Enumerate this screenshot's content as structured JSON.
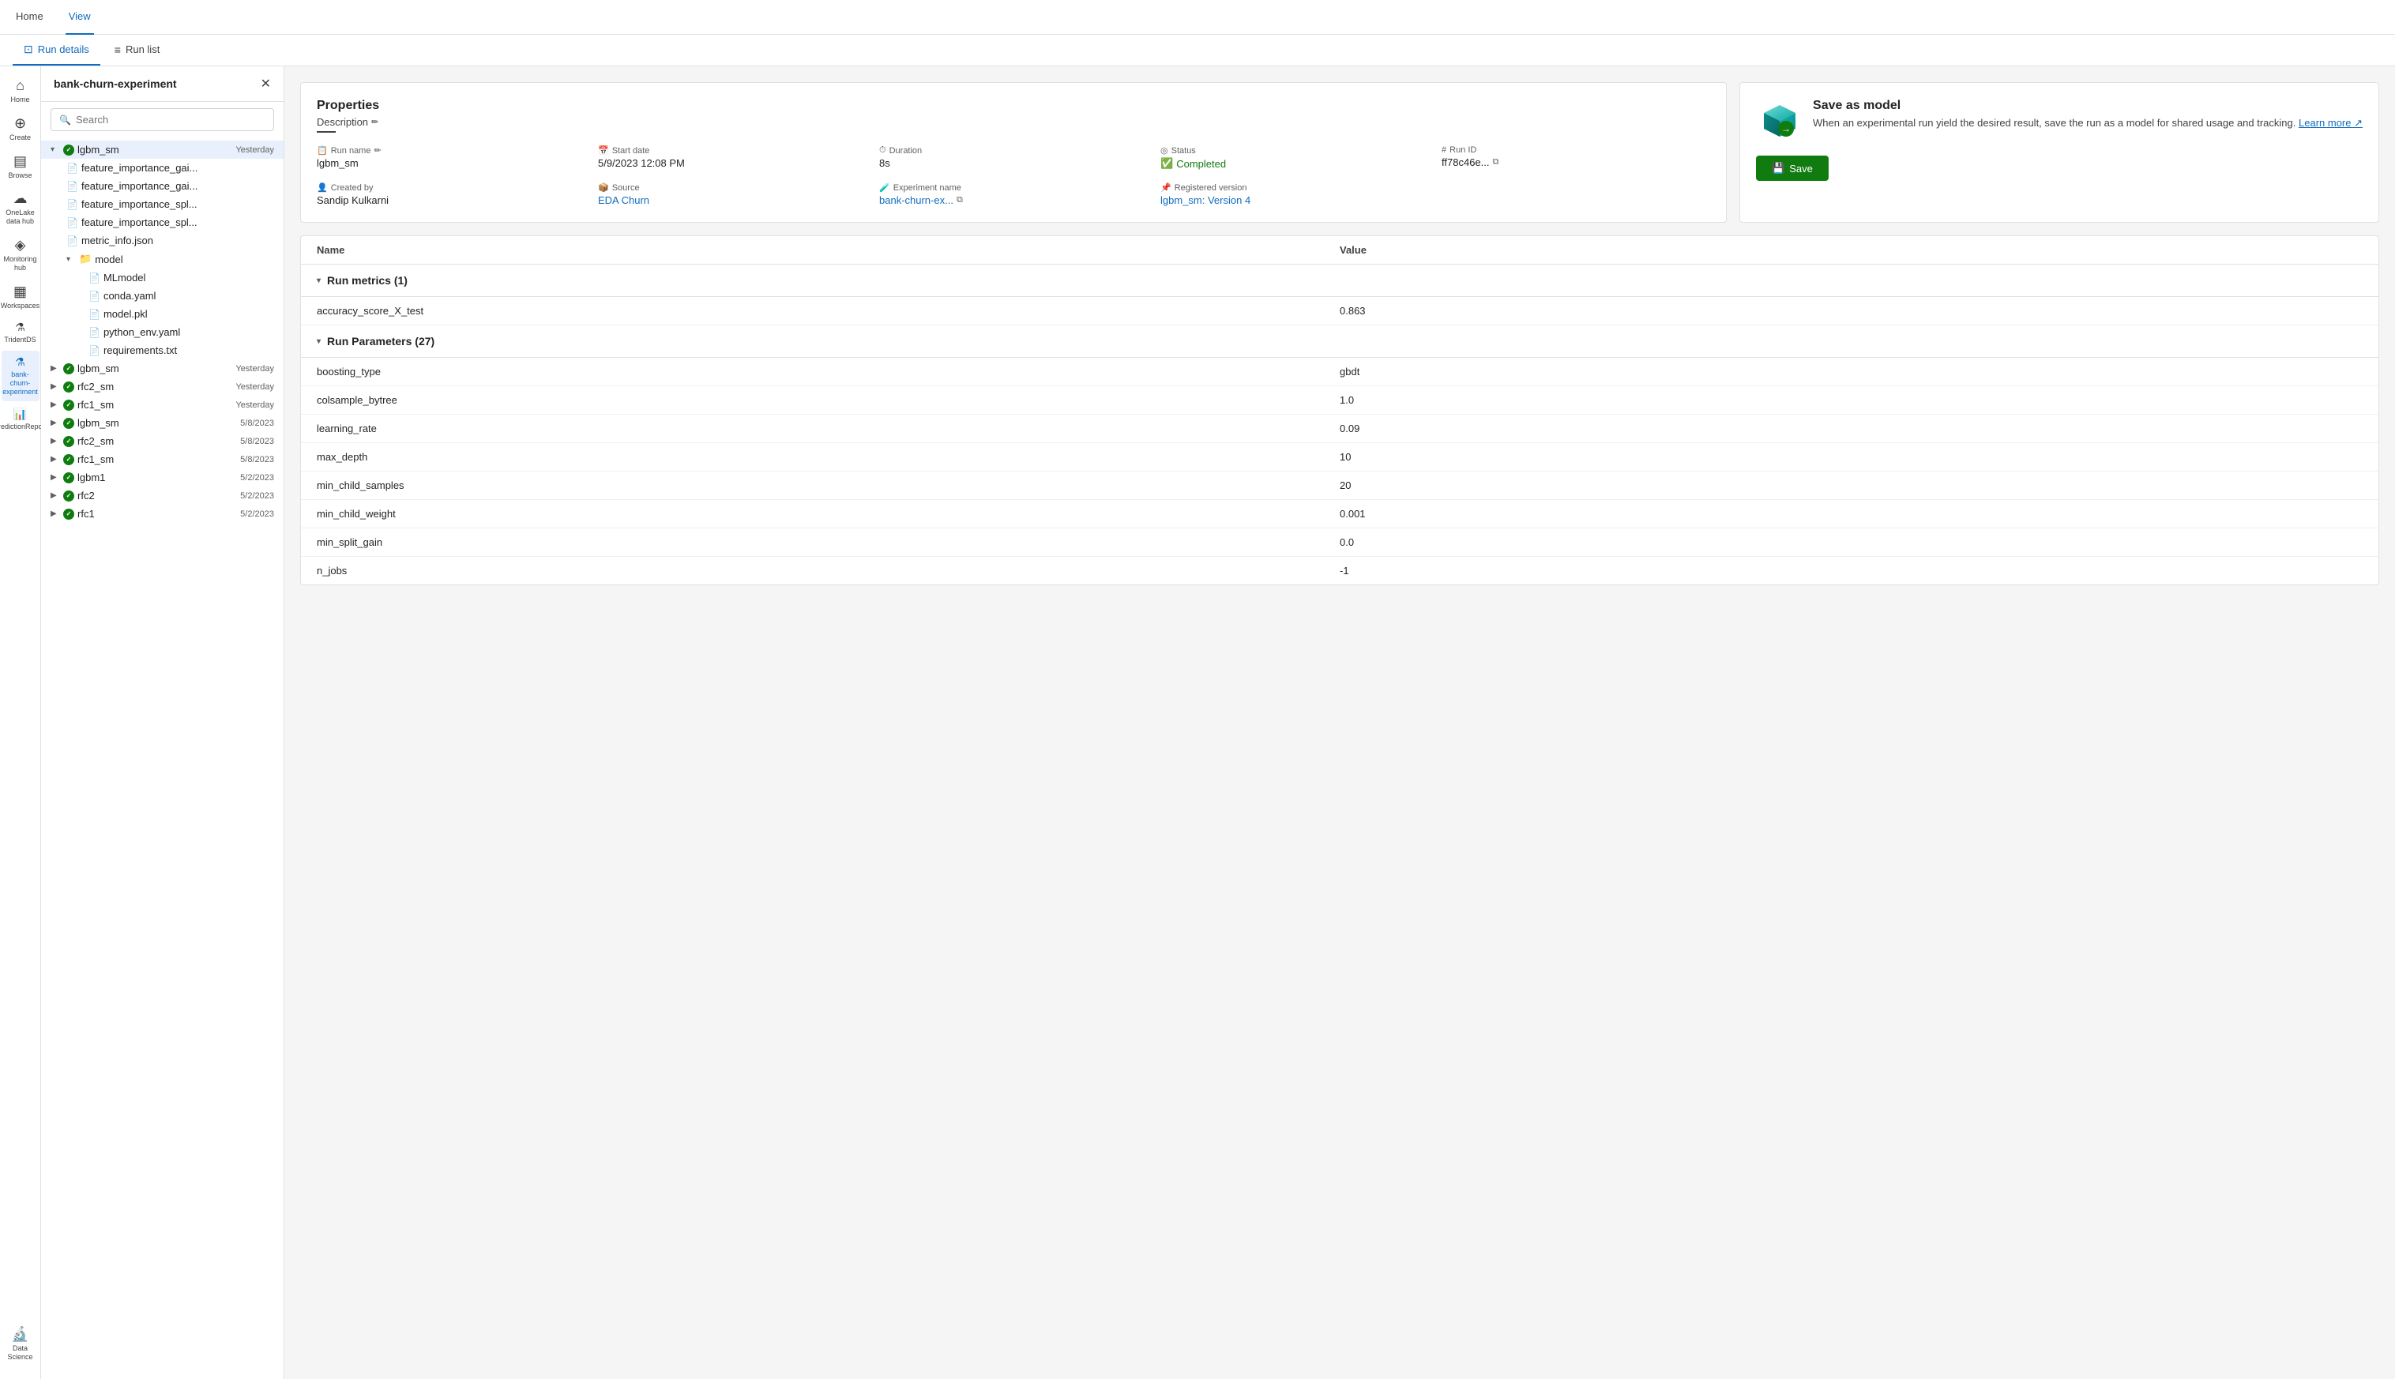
{
  "nav": {
    "home_label": "Home",
    "view_label": "View"
  },
  "tabs": [
    {
      "id": "run-details",
      "label": "Run details",
      "icon": "⊡",
      "active": true
    },
    {
      "id": "run-list",
      "label": "Run list",
      "icon": "≡",
      "active": false
    }
  ],
  "nav_sidebar": {
    "items": [
      {
        "id": "home",
        "icon": "⌂",
        "label": "Home"
      },
      {
        "id": "create",
        "icon": "+",
        "label": "Create"
      },
      {
        "id": "browse",
        "icon": "▤",
        "label": "Browse"
      },
      {
        "id": "onelake",
        "icon": "☁",
        "label": "OneLake data hub"
      },
      {
        "id": "monitoring",
        "icon": "◈",
        "label": "Monitoring hub"
      },
      {
        "id": "workspaces",
        "icon": "▦",
        "label": "Workspaces"
      },
      {
        "id": "tridentds",
        "icon": "🔱",
        "label": "TridentDS"
      },
      {
        "id": "experiment",
        "icon": "⚗",
        "label": "bank-churn-experiment",
        "active": true
      },
      {
        "id": "prediction",
        "icon": "📊",
        "label": "PredictionReport"
      }
    ],
    "bottom": [
      {
        "id": "data-science",
        "icon": "🔬",
        "label": "Data Science"
      }
    ]
  },
  "experiment_panel": {
    "title": "bank-churn-experiment",
    "search_placeholder": "Search",
    "tree": [
      {
        "id": "lgbm_sm_main",
        "label": "lgbm_sm",
        "date": "Yesterday",
        "expanded": true,
        "status": "completed",
        "children": [
          {
            "id": "fi_gai1",
            "label": "feature_importance_gai...",
            "type": "file"
          },
          {
            "id": "fi_gai2",
            "label": "feature_importance_gai...",
            "type": "file"
          },
          {
            "id": "fi_spl1",
            "label": "feature_importance_spl...",
            "type": "file"
          },
          {
            "id": "fi_spl2",
            "label": "feature_importance_spl...",
            "type": "file"
          },
          {
            "id": "metric_info",
            "label": "metric_info.json",
            "type": "file"
          },
          {
            "id": "model_folder",
            "label": "model",
            "type": "folder",
            "expanded": true,
            "children": [
              {
                "id": "mlmodel",
                "label": "MLmodel",
                "type": "file"
              },
              {
                "id": "conda_yaml",
                "label": "conda.yaml",
                "type": "file"
              },
              {
                "id": "model_pkl",
                "label": "model.pkl",
                "type": "file"
              },
              {
                "id": "python_env",
                "label": "python_env.yaml",
                "type": "file"
              },
              {
                "id": "requirements",
                "label": "requirements.txt",
                "type": "file"
              }
            ]
          }
        ]
      },
      {
        "id": "lgbm_sm_2",
        "label": "lgbm_sm",
        "date": "Yesterday",
        "status": "completed"
      },
      {
        "id": "rfc2_sm_1",
        "label": "rfc2_sm",
        "date": "Yesterday",
        "status": "completed"
      },
      {
        "id": "rfc1_sm_1",
        "label": "rfc1_sm",
        "date": "Yesterday",
        "status": "completed"
      },
      {
        "id": "lgbm_sm_3",
        "label": "lgbm_sm",
        "date": "5/8/2023",
        "status": "completed"
      },
      {
        "id": "rfc2_sm_2",
        "label": "rfc2_sm",
        "date": "5/8/2023",
        "status": "completed"
      },
      {
        "id": "rfc1_sm_2",
        "label": "rfc1_sm",
        "date": "5/8/2023",
        "status": "completed"
      },
      {
        "id": "lgbm1_1",
        "label": "lgbm1",
        "date": "5/2/2023",
        "status": "completed"
      },
      {
        "id": "rfc2_1",
        "label": "rfc2",
        "date": "5/2/2023",
        "status": "completed"
      },
      {
        "id": "rfc1_1",
        "label": "rfc1",
        "date": "5/2/2023",
        "status": "completed"
      }
    ]
  },
  "properties": {
    "title": "Properties",
    "description_label": "Description",
    "run_name_label": "Run name",
    "run_name_value": "lgbm_sm",
    "start_date_label": "Start date",
    "start_date_value": "5/9/2023 12:08 PM",
    "duration_label": "Duration",
    "duration_value": "8s",
    "status_label": "Status",
    "status_value": "Completed",
    "run_id_label": "Run ID",
    "run_id_value": "ff78c46e...",
    "created_by_label": "Created by",
    "created_by_value": "Sandip Kulkarni",
    "source_label": "Source",
    "source_value": "EDA Churn",
    "experiment_name_label": "Experiment name",
    "experiment_name_value": "bank-churn-ex...",
    "registered_version_label": "Registered version",
    "registered_version_value": "lgbm_sm: Version 4"
  },
  "save_as_model": {
    "title": "Save as model",
    "description": "When an experimental run yield the desired result, save the run as a model for shared usage and tracking.",
    "learn_more": "Learn more",
    "save_btn": "Save"
  },
  "metrics_table": {
    "col_name": "Name",
    "col_value": "Value",
    "run_metrics_label": "Run metrics (1)",
    "run_metrics": [
      {
        "name": "accuracy_score_X_test",
        "value": "0.863"
      }
    ],
    "run_params_label": "Run Parameters (27)",
    "run_params": [
      {
        "name": "boosting_type",
        "value": "gbdt"
      },
      {
        "name": "colsample_bytree",
        "value": "1.0"
      },
      {
        "name": "learning_rate",
        "value": "0.09"
      },
      {
        "name": "max_depth",
        "value": "10"
      },
      {
        "name": "min_child_samples",
        "value": "20"
      },
      {
        "name": "min_child_weight",
        "value": "0.001"
      },
      {
        "name": "min_split_gain",
        "value": "0.0"
      },
      {
        "name": "n_jobs",
        "value": "-1"
      }
    ]
  }
}
